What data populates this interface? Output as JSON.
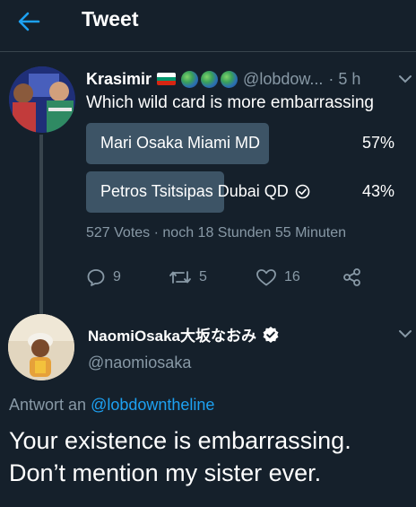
{
  "header": {
    "title": "Tweet"
  },
  "parent_tweet": {
    "name": "Krasimir",
    "handle": "@lobdow...",
    "time": "· 5 h",
    "text": "Which wild card is more embarrassing",
    "poll": {
      "options": [
        {
          "label": "Mari Osaka Miami MD",
          "percent_text": "57%",
          "percent": 57,
          "selected": false
        },
        {
          "label": "Petros Tsitsipas Dubai QD",
          "percent_text": "43%",
          "percent": 43,
          "selected": true
        }
      ],
      "votes": "527 Votes",
      "separator": "·",
      "remaining": "noch 18 Stunden 55 Minuten"
    },
    "stats": {
      "replies": "9",
      "retweets": "5",
      "likes": "16"
    }
  },
  "reply_tweet": {
    "name": "NaomiOsaka大坂なおみ",
    "handle": "@naomiosaka",
    "reply_prefix": "Antwort an",
    "reply_mention": "@lobdowntheline",
    "text_lines": [
      "Your existence is embarrassing.",
      "Don’t mention my sister ever."
    ]
  },
  "colors": {
    "background": "#15202b",
    "accent": "#1da1f2",
    "muted_text": "#8899a6",
    "poll_fill": "#3d5466",
    "divider": "#38444d"
  },
  "icons": {
    "back": "arrow-left-icon",
    "caret": "chevron-down-icon",
    "reply": "comment-icon",
    "retweet": "retweet-icon",
    "like": "heart-icon",
    "share": "share-icon",
    "verified": "verified-badge-icon",
    "poll_check": "check-circle-icon"
  }
}
